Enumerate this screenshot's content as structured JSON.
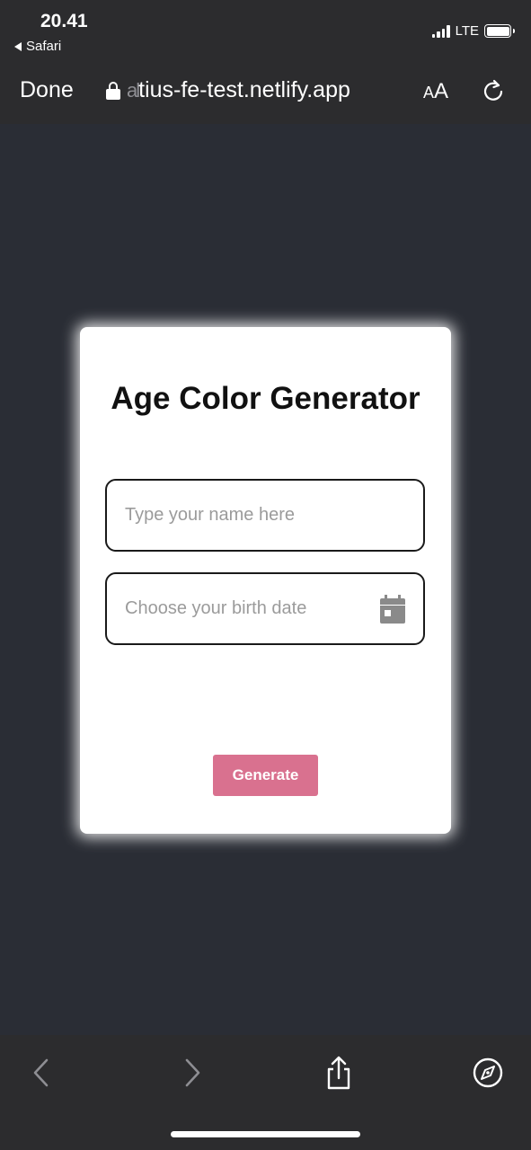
{
  "status_bar": {
    "time": "20.41",
    "back_app": "Safari",
    "network": "LTE"
  },
  "browser": {
    "done_label": "Done",
    "url_faded_prefix": "al",
    "url_text": "tius-fe-test.netlify.app",
    "text_size_small": "A",
    "text_size_big": "A"
  },
  "card": {
    "title": "Age Color Generator",
    "name_placeholder": "Type your name here",
    "date_placeholder": "Choose your birth date",
    "generate_label": "Generate",
    "accent_color": "#d9718f"
  },
  "toolbar": {
    "icons": [
      "back-arrow-icon",
      "forward-arrow-icon",
      "share-icon",
      "compass-icon"
    ]
  },
  "colors": {
    "page_background": "#2a2d35",
    "chrome_background": "#2c2c2e",
    "card_background": "#ffffff"
  }
}
